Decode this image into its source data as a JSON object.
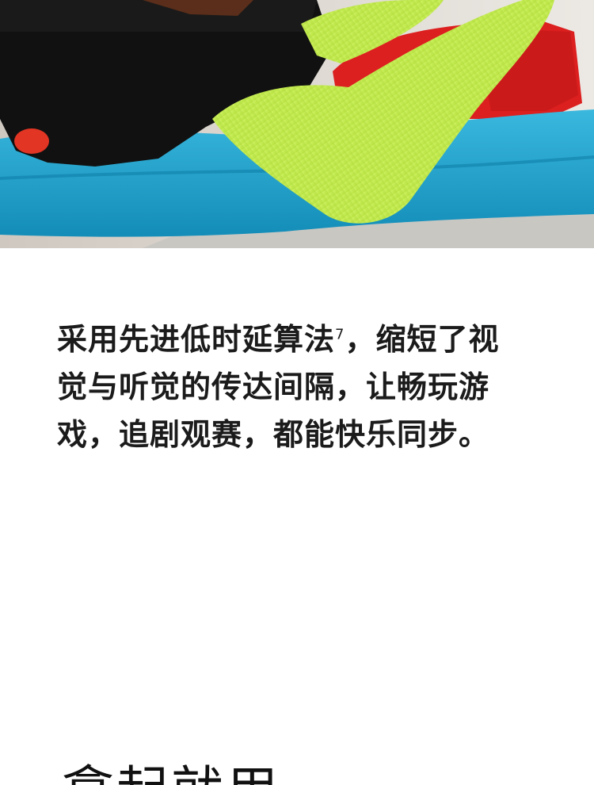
{
  "hero": {
    "image_icon": "photo-person-with-green-sleeve-on-blue-sofa"
  },
  "description": {
    "line1_text": "采用先进低时延算法",
    "footnote_number": "7",
    "line1_tail": "，缩短了视",
    "line2": "觉与听觉的传达间隔，让畅玩游",
    "line3": "戏，追剧观赛，都能快乐同步。"
  },
  "next_section": {
    "heading": "拿起就用"
  },
  "colors": {
    "background": "#ffffff",
    "text": "#1b1b1b",
    "sleeve_green": "#c9ef58",
    "sofa_blue": "#1fa6cf",
    "pillow_red": "#dc1f1f",
    "shirt_black": "#111111"
  }
}
